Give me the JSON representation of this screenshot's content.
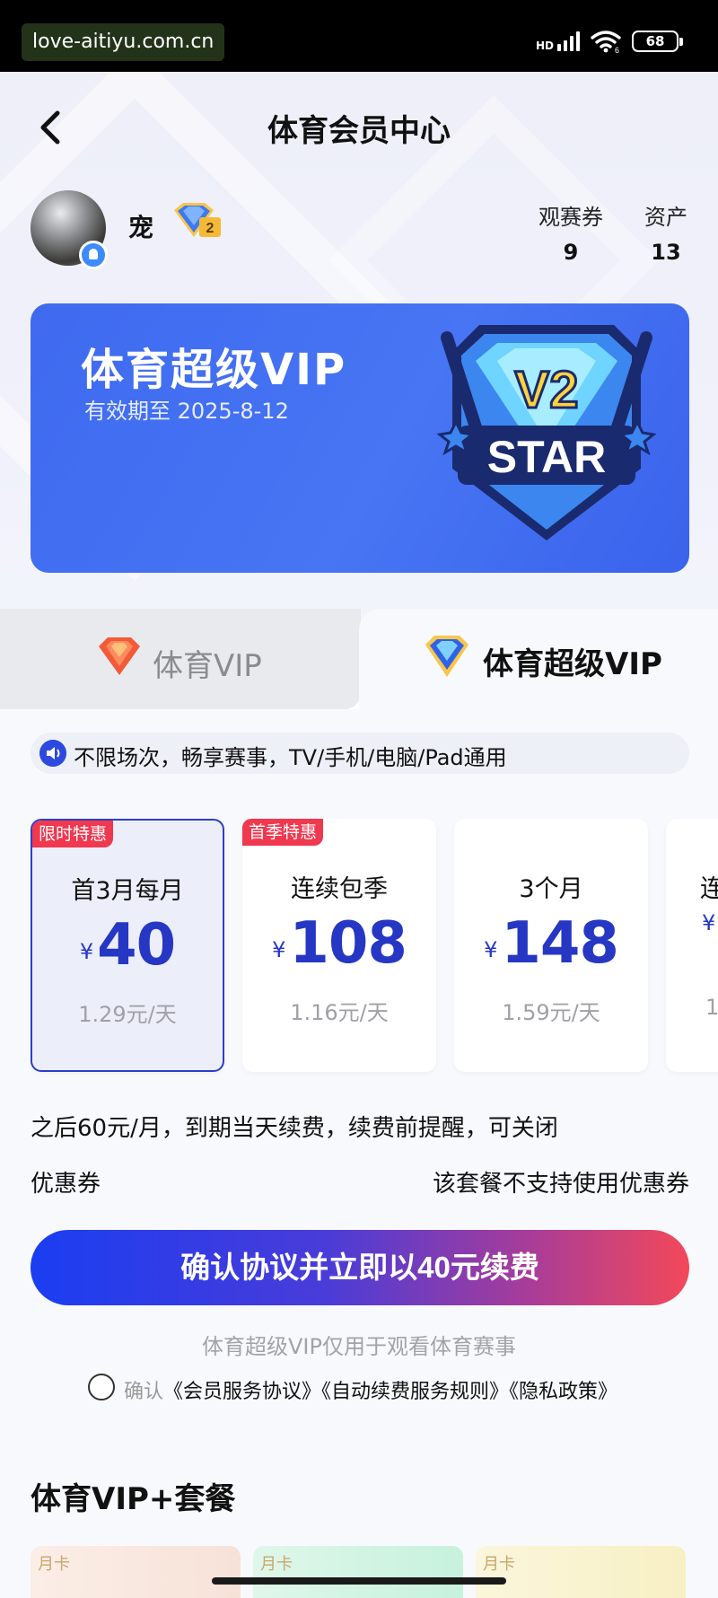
{
  "status_bar": {
    "watermark": "love-aitiyu.com.cn",
    "network": "HD",
    "wifi_sub": "6",
    "battery": "68"
  },
  "header": {
    "title": "体育会员中心",
    "back_icon": "chevron-left-icon"
  },
  "user": {
    "name": "宠",
    "level_badge": "V2",
    "stats": [
      {
        "label": "观赛券",
        "value": "9"
      },
      {
        "label": "资产",
        "value": "13"
      }
    ]
  },
  "vip_card": {
    "title": "体育超级VIP",
    "expiry": "有效期至 2025-8-12",
    "emblem_top": "V2",
    "emblem_bottom": "STAR",
    "color": "#4371f2"
  },
  "tabs": [
    {
      "label": "体育VIP",
      "icon": "red-diamond-icon",
      "selected": false
    },
    {
      "label": "体育超级VIP",
      "icon": "blue-diamond-icon",
      "selected": true
    }
  ],
  "notice": {
    "icon": "speaker-icon",
    "text": "不限场次，畅享赛事，TV/手机/电脑/Pad通用"
  },
  "plans": [
    {
      "tag": "限时特惠",
      "name": "首3月每月",
      "currency": "¥",
      "price": "40",
      "daily": "1.29元/天",
      "selected": true
    },
    {
      "tag": "首季特惠",
      "name": "连续包季",
      "currency": "¥",
      "price": "108",
      "daily": "1.16元/天",
      "selected": false
    },
    {
      "tag": "",
      "name": "3个月",
      "currency": "¥",
      "price": "148",
      "daily": "1.59元/天",
      "selected": false
    },
    {
      "tag": "",
      "name": "连",
      "currency": "¥",
      "price": "",
      "daily": "1",
      "selected": false
    }
  ],
  "renewal_note": "之后60元/月，到期当天续费，续费前提醒，可关闭",
  "coupon": {
    "label": "优惠券",
    "value": "该套餐不支持使用优惠券"
  },
  "confirm_button": "确认协议并立即以40元续费",
  "usage_note": "体育超级VIP仅用于观看体育赛事",
  "agreement": {
    "lead": "确认",
    "links": [
      "《会员服务协议》",
      "《自动续费服务规则》",
      "《隐私政策》"
    ]
  },
  "section_title": "体育VIP+套餐",
  "packages": [
    {
      "mini_label": "月卡"
    },
    {
      "mini_label": "月卡"
    },
    {
      "mini_label": "月卡"
    }
  ],
  "colors": {
    "accent_blue": "#2637c4",
    "tag_red": "#f0384f",
    "button_start": "#1b3df2",
    "button_end": "#f3485a"
  }
}
